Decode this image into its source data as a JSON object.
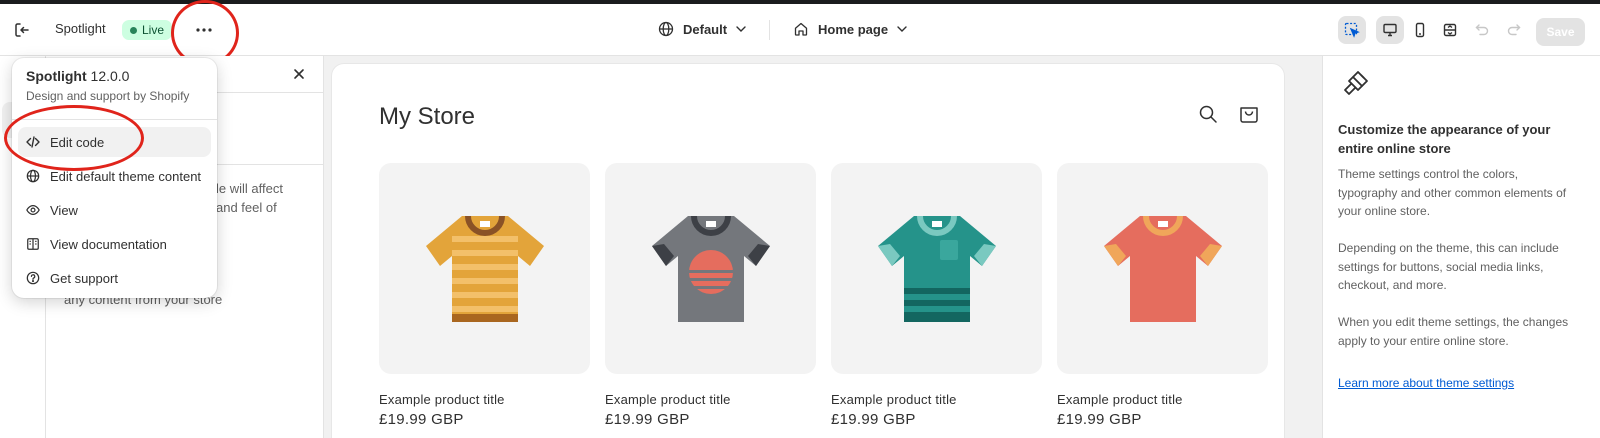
{
  "topbar": {
    "theme_name": "Spotlight",
    "status_badge": "Live",
    "template_select": "Default",
    "page_select": "Home page",
    "save_label": "Save"
  },
  "menu": {
    "theme_name": "Spotlight",
    "version": "12.0.0",
    "subtitle": "Design and support by Shopify",
    "items": [
      {
        "label": "Edit code",
        "icon": "code-icon"
      },
      {
        "label": "Edit default theme content",
        "icon": "globe-icon"
      },
      {
        "label": "View",
        "icon": "eye-icon"
      },
      {
        "label": "View documentation",
        "icon": "book-icon"
      },
      {
        "label": "Get support",
        "icon": "question-circle-icon"
      }
    ]
  },
  "left_panel": {
    "text1": "le will affect\nand feel of",
    "text2": "when you\nwill not lose\nany content from your store"
  },
  "preview": {
    "store_name": "My Store",
    "products": [
      {
        "title": "Example product title",
        "price": "£19.99 GBP",
        "shirt_color": "#e3a43a"
      },
      {
        "title": "Example product title",
        "price": "£19.99 GBP",
        "shirt_color": "#74777c"
      },
      {
        "title": "Example product title",
        "price": "£19.99 GBP",
        "shirt_color": "#25938a"
      },
      {
        "title": "Example product title",
        "price": "£19.99 GBP",
        "shirt_color": "#e56d5e"
      }
    ]
  },
  "inspector": {
    "title": "Customize the appearance of your entire online store",
    "para1": "Theme settings control the colors, typography and other common elements of your online store.",
    "para2": "Depending on the theme, this can include settings for buttons, social media links, checkout, and more.",
    "para3": "When you edit theme settings, the changes apply to your entire online store.",
    "link": "Learn more about theme settings"
  },
  "colors": {
    "accent_link": "#005bd3",
    "badge_bg": "#cdfee1",
    "annotation": "#e0241b"
  }
}
